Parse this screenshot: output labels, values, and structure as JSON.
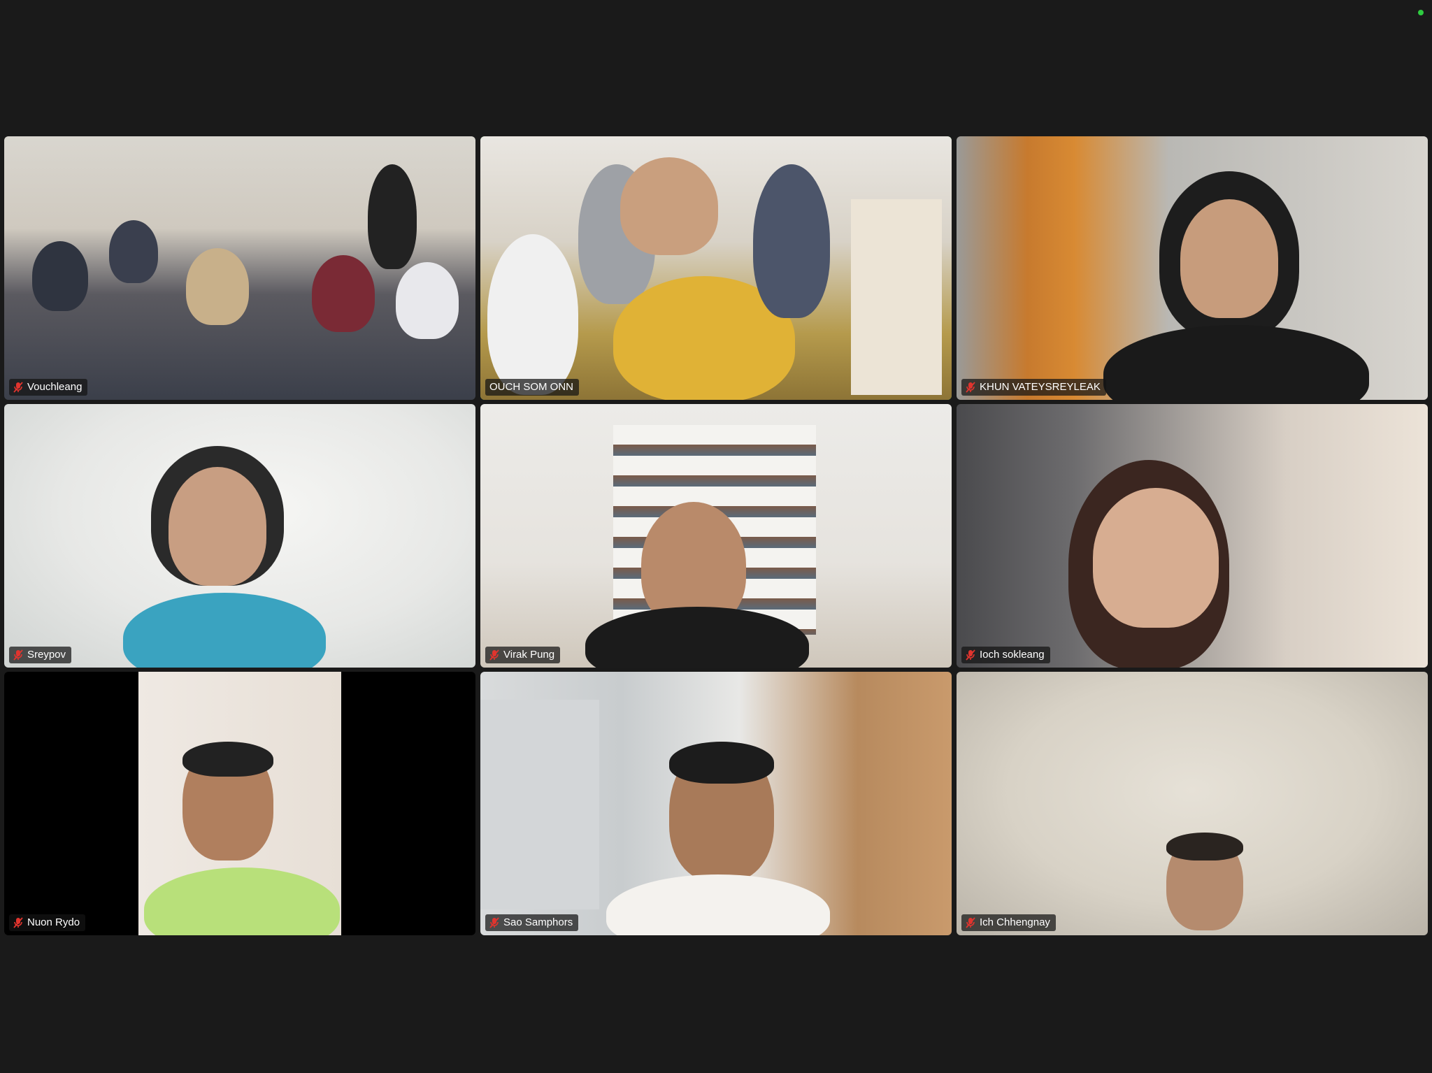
{
  "meeting": {
    "status_indicator_color": "#2ecc40",
    "active_speaker_color": "#35c444"
  },
  "participants": [
    {
      "name": "Vouchleang",
      "muted": true,
      "active": false
    },
    {
      "name": "OUCH SOM ONN",
      "muted": false,
      "active": true
    },
    {
      "name": "KHUN VATEYSREYLEAK",
      "muted": true,
      "active": false
    },
    {
      "name": "Sreypov",
      "muted": true,
      "active": false
    },
    {
      "name": "Virak Pung",
      "muted": true,
      "active": false
    },
    {
      "name": "Ioch sokleang",
      "muted": true,
      "active": false
    },
    {
      "name": "Nuon Rydo",
      "muted": true,
      "active": false
    },
    {
      "name": "Sao Samphors",
      "muted": true,
      "active": false
    },
    {
      "name": "Ich Chhengnay",
      "muted": true,
      "active": false
    }
  ],
  "icons": {
    "muted": "microphone-muted-icon"
  }
}
